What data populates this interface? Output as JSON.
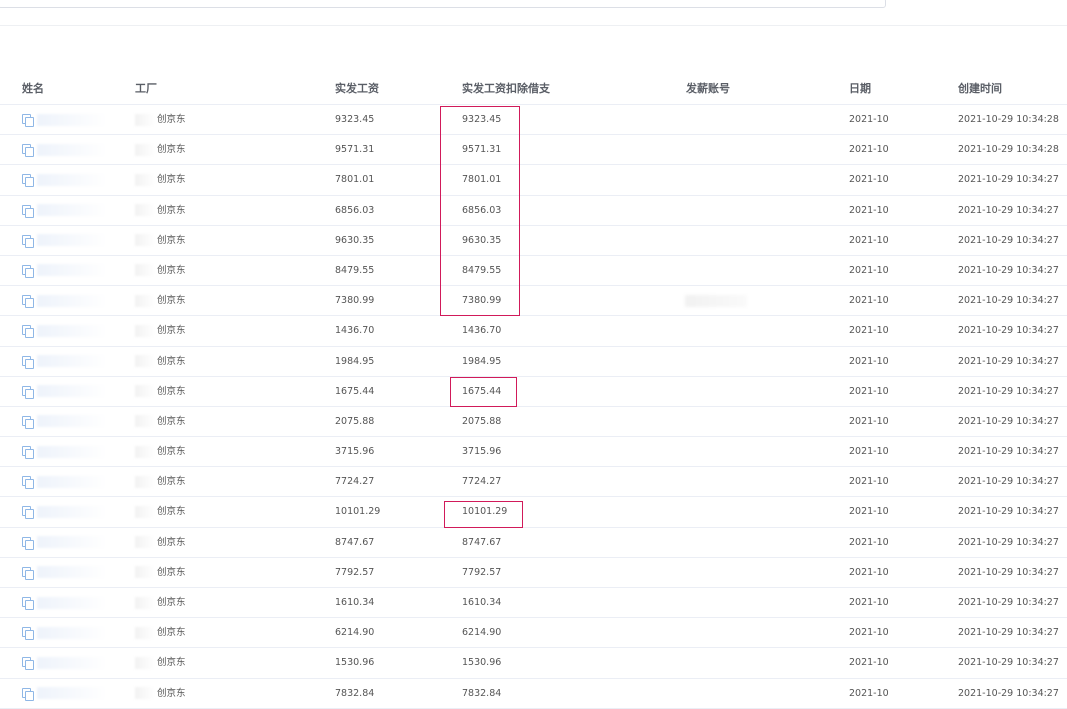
{
  "columns": [
    "姓名",
    "工厂",
    "实发工资",
    "实发工资扣除借支",
    "发薪账号",
    "日期",
    "创建时间"
  ],
  "rows": [
    {
      "factory": "创京东",
      "salary": "9323.45",
      "net": "9323.45",
      "date": "2021-10",
      "created": "2021-10-29 10:34:28"
    },
    {
      "factory": "创京东",
      "salary": "9571.31",
      "net": "9571.31",
      "date": "2021-10",
      "created": "2021-10-29 10:34:28"
    },
    {
      "factory": "创京东",
      "salary": "7801.01",
      "net": "7801.01",
      "date": "2021-10",
      "created": "2021-10-29 10:34:27"
    },
    {
      "factory": "创京东",
      "salary": "6856.03",
      "net": "6856.03",
      "date": "2021-10",
      "created": "2021-10-29 10:34:27"
    },
    {
      "factory": "创京东",
      "salary": "9630.35",
      "net": "9630.35",
      "date": "2021-10",
      "created": "2021-10-29 10:34:27"
    },
    {
      "factory": "创京东",
      "salary": "8479.55",
      "net": "8479.55",
      "date": "2021-10",
      "created": "2021-10-29 10:34:27"
    },
    {
      "factory": "创京东",
      "salary": "7380.99",
      "net": "7380.99",
      "date": "2021-10",
      "created": "2021-10-29 10:34:27"
    },
    {
      "factory": "创京东",
      "salary": "1436.70",
      "net": "1436.70",
      "date": "2021-10",
      "created": "2021-10-29 10:34:27"
    },
    {
      "factory": "创京东",
      "salary": "1984.95",
      "net": "1984.95",
      "date": "2021-10",
      "created": "2021-10-29 10:34:27"
    },
    {
      "factory": "创京东",
      "salary": "1675.44",
      "net": "1675.44",
      "date": "2021-10",
      "created": "2021-10-29 10:34:27"
    },
    {
      "factory": "创京东",
      "salary": "2075.88",
      "net": "2075.88",
      "date": "2021-10",
      "created": "2021-10-29 10:34:27"
    },
    {
      "factory": "创京东",
      "salary": "3715.96",
      "net": "3715.96",
      "date": "2021-10",
      "created": "2021-10-29 10:34:27"
    },
    {
      "factory": "创京东",
      "salary": "7724.27",
      "net": "7724.27",
      "date": "2021-10",
      "created": "2021-10-29 10:34:27"
    },
    {
      "factory": "创京东",
      "salary": "10101.29",
      "net": "10101.29",
      "date": "2021-10",
      "created": "2021-10-29 10:34:27"
    },
    {
      "factory": "创京东",
      "salary": "8747.67",
      "net": "8747.67",
      "date": "2021-10",
      "created": "2021-10-29 10:34:27"
    },
    {
      "factory": "创京东",
      "salary": "7792.57",
      "net": "7792.57",
      "date": "2021-10",
      "created": "2021-10-29 10:34:27"
    },
    {
      "factory": "创京东",
      "salary": "1610.34",
      "net": "1610.34",
      "date": "2021-10",
      "created": "2021-10-29 10:34:27"
    },
    {
      "factory": "创京东",
      "salary": "6214.90",
      "net": "6214.90",
      "date": "2021-10",
      "created": "2021-10-29 10:34:27"
    },
    {
      "factory": "创京东",
      "salary": "1530.96",
      "net": "1530.96",
      "date": "2021-10",
      "created": "2021-10-29 10:34:27"
    },
    {
      "factory": "创京东",
      "salary": "7832.84",
      "net": "7832.84",
      "date": "2021-10",
      "created": "2021-10-29 10:34:27"
    }
  ],
  "colors": {
    "highlight": "#d11a5a",
    "copy_icon": "#8fb7e6",
    "border": "#ebeef5"
  }
}
